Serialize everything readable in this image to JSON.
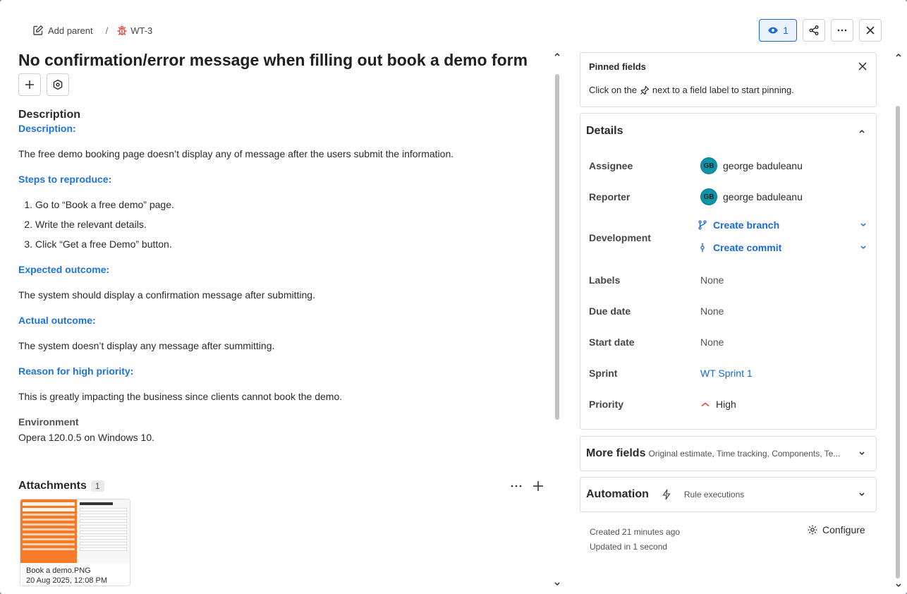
{
  "breadcrumb": {
    "add_parent": "Add parent",
    "separator": "/",
    "issue_key": "WT-3"
  },
  "header": {
    "watch_count": "1"
  },
  "issue": {
    "title": "No confirmation/error message when filling out book a demo form",
    "description_heading": "Description",
    "description": {
      "h_description": "Description:",
      "description": "The free demo booking page doesn’t display any of message after the users submit the information.",
      "h_steps": "Steps to reproduce:",
      "steps": [
        "Go to “Book a free demo” page.",
        "Write the relevant details.",
        "Click “Get a free Demo” button."
      ],
      "h_expected": "Expected outcome:",
      "expected": "The system should display a confirmation message after submitting.",
      "h_actual": "Actual outcome:",
      "actual": "The system doesn’t display any message after summitting.",
      "h_reason": "Reason for high priority:",
      "reason": "This is greatly impacting the business since clients cannot book the demo."
    },
    "environment_label": "Environment",
    "environment": "Opera 120.0.5 on Windows 10.",
    "attachments_label": "Attachments",
    "attachments_count": "1",
    "attachment": {
      "filename": "Book a demo.PNG",
      "date": "20 Aug 2025, 12:08 PM",
      "thumb_left_text": "ge Your People and\ntions In One Place",
      "thumb_right_text": "We Just Need a Few Details."
    }
  },
  "pinned": {
    "title": "Pinned fields",
    "text_before": "Click on the",
    "text_after": "next to a field label to start pinning."
  },
  "details": {
    "title": "Details",
    "assignee_label": "Assignee",
    "assignee_initials": "GB",
    "assignee": "george baduleanu",
    "reporter_label": "Reporter",
    "reporter_initials": "GB",
    "reporter": "george baduleanu",
    "development_label": "Development",
    "create_branch": "Create branch",
    "create_commit": "Create commit",
    "labels_label": "Labels",
    "labels": "None",
    "due_label": "Due date",
    "due": "None",
    "start_label": "Start date",
    "start": "None",
    "sprint_label": "Sprint",
    "sprint": "WT Sprint 1",
    "priority_label": "Priority",
    "priority": "High",
    "priority_color": "#e2483d"
  },
  "more_fields": {
    "title": "More fields",
    "summary": "Original estimate, Time tracking, Components, Te..."
  },
  "automation": {
    "title": "Automation",
    "summary": "Rule executions"
  },
  "meta": {
    "created": "Created 21 minutes ago",
    "updated": "Updated in 1 second",
    "configure": "Configure"
  },
  "colors": {
    "accent": "#1868db",
    "heading_blue": "#1e73d8",
    "avatar": "#0e93a8"
  }
}
